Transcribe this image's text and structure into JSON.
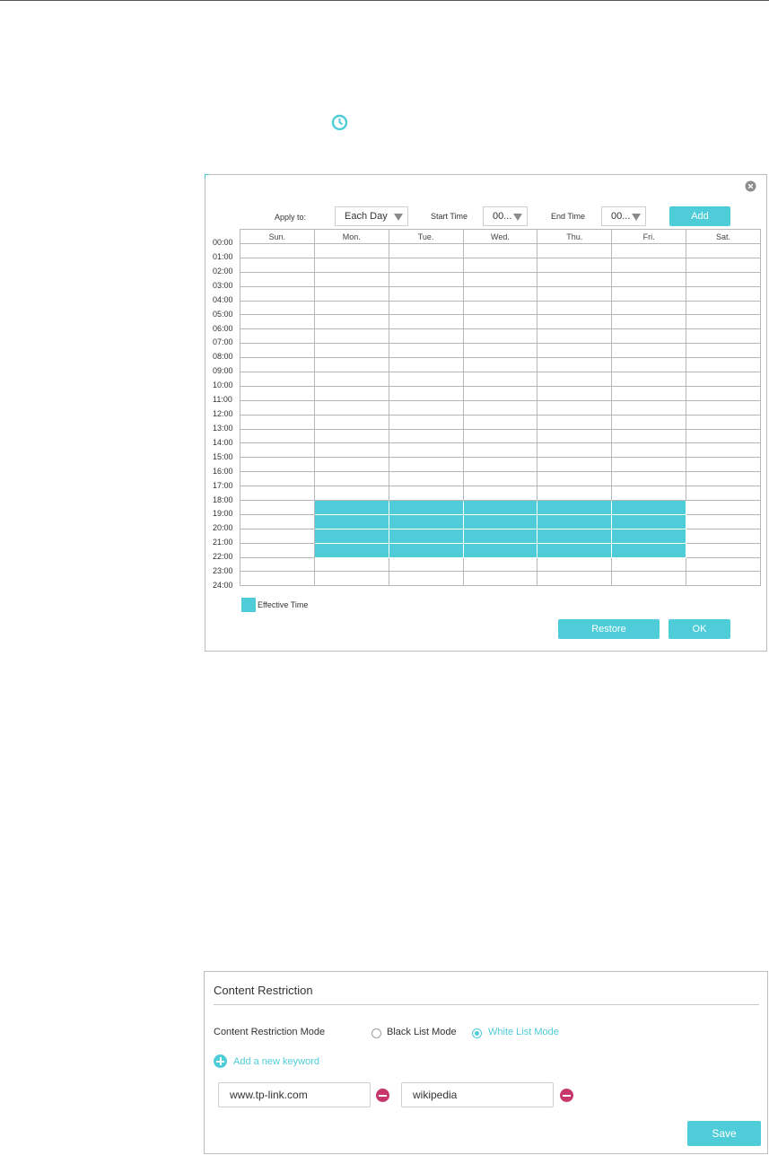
{
  "schedule": {
    "apply_to_label": "Apply to:",
    "apply_to_value": "Each Day",
    "start_time_label": "Start Time",
    "start_time_value": "00...",
    "end_time_label": "End Time",
    "end_time_value": "00...",
    "add_label": "Add",
    "days": [
      "Sun.",
      "Mon.",
      "Tue.",
      "Wed.",
      "Thu.",
      "Fri.",
      "Sat."
    ],
    "times": [
      "00:00",
      "01:00",
      "02:00",
      "03:00",
      "04:00",
      "05:00",
      "06:00",
      "07:00",
      "08:00",
      "09:00",
      "10:00",
      "11:00",
      "12:00",
      "13:00",
      "14:00",
      "15:00",
      "16:00",
      "17:00",
      "18:00",
      "19:00",
      "20:00",
      "21:00",
      "22:00",
      "23:00",
      "24:00"
    ],
    "effective": {
      "days": [
        "Mon.",
        "Tue.",
        "Wed.",
        "Thu.",
        "Fri."
      ],
      "start": "18:00",
      "end": "22:00"
    },
    "legend_label": "Effective Time",
    "restore_label": "Restore",
    "ok_label": "OK",
    "accent_color": "#4ecdd8"
  },
  "content_restriction": {
    "title": "Content Restriction",
    "mode_label": "Content Restriction Mode",
    "modes": [
      {
        "label": "Black List Mode",
        "checked": false
      },
      {
        "label": "White List Mode",
        "checked": true
      }
    ],
    "add_keyword_label": "Add a new keyword",
    "keywords": [
      "www.tp-link.com",
      "wikipedia"
    ],
    "save_label": "Save",
    "remove_color": "#c8376c"
  },
  "icons": {
    "clock": "clock-icon",
    "close": "close-icon",
    "add": "plus-circle-icon",
    "remove": "minus-circle-icon"
  }
}
